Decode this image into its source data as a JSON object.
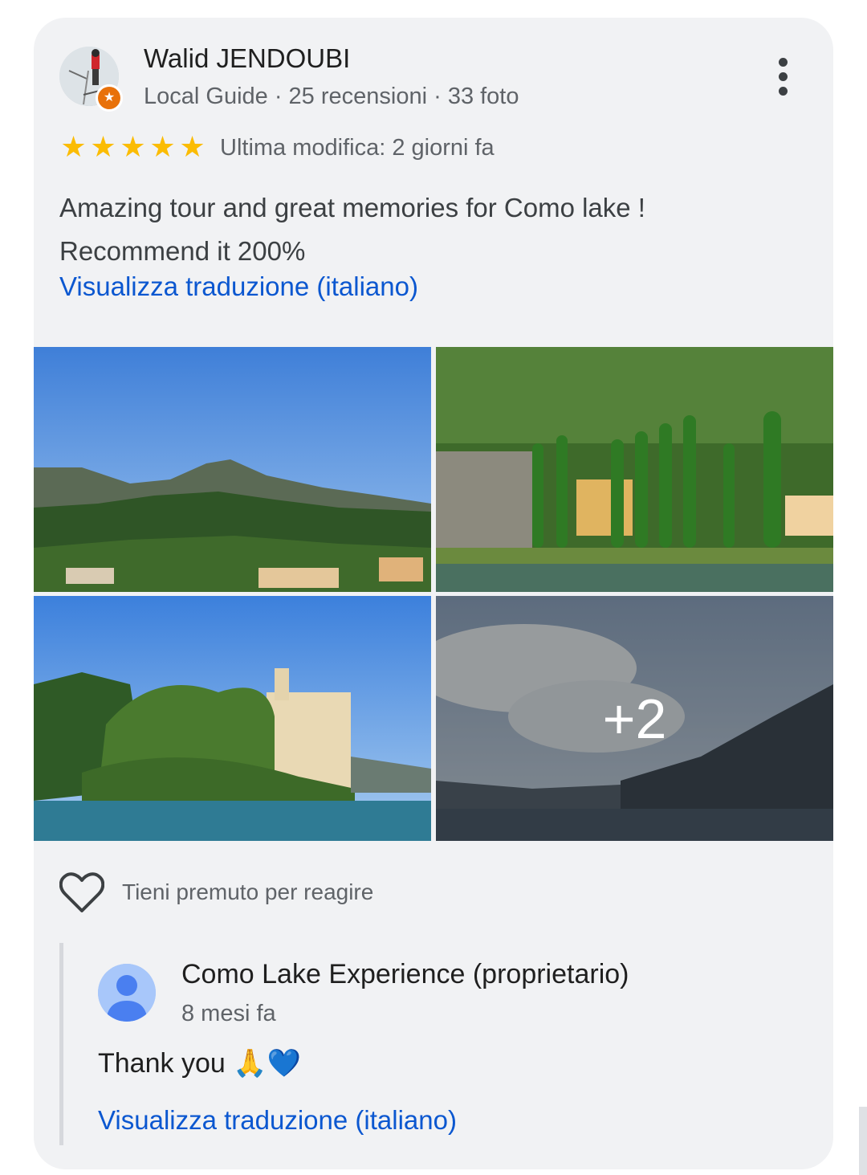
{
  "review": {
    "author_name": "Walid JENDOUBI",
    "author_meta": "Local Guide · 25 recensioni · 33 foto",
    "rating": 5,
    "rating_max": 5,
    "edited_label": "Ultima modifica: 2 giorni fa",
    "text": "Amazing tour and great memories for Como lake ! Recommend it 200%",
    "translate_link": "Visualizza traduzione (italiano)",
    "more_photos_label": "+2",
    "react_hint": "Tieni premuto per reagire"
  },
  "owner_reply": {
    "name": "Como Lake Experience (proprietario)",
    "time": "8 mesi fa",
    "text": "Thank you 🙏💙",
    "translate_link": "Visualizza traduzione (italiano)"
  },
  "colors": {
    "star": "#fbbc04",
    "link": "#0b57d0",
    "local_guide_badge": "#e8710a"
  },
  "icons": {
    "more": "more-vert-icon",
    "star": "star-icon",
    "heart": "heart-outline-icon",
    "badge": "local-guide-star-icon",
    "owner_avatar": "default-profile-icon"
  }
}
